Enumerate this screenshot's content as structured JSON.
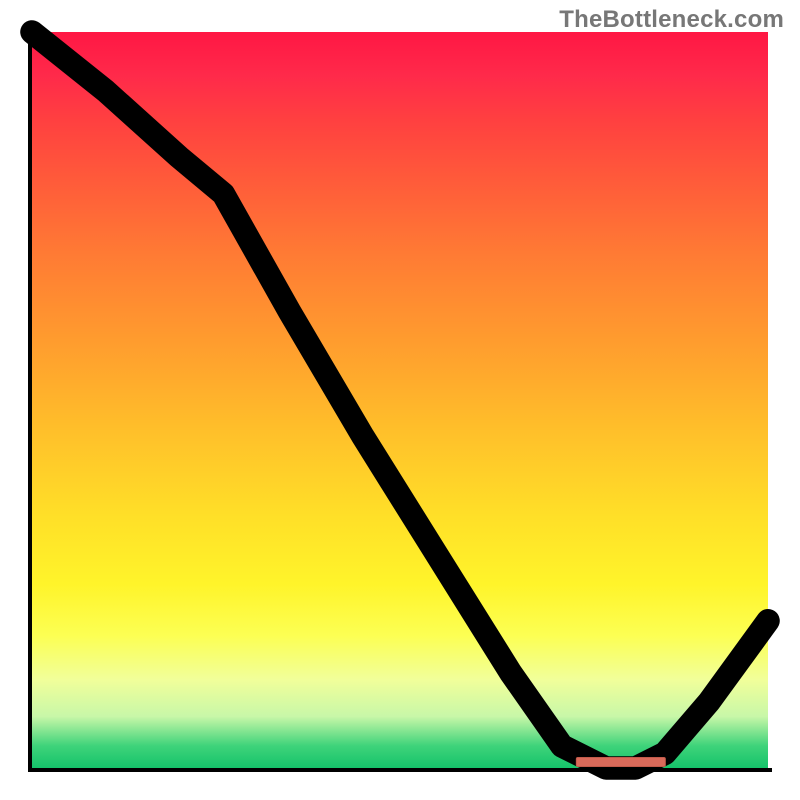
{
  "watermark": "TheBottleneck.com",
  "chart_data": {
    "type": "line",
    "title": "",
    "xlabel": "",
    "ylabel": "",
    "xlim": [
      0,
      100
    ],
    "ylim": [
      0,
      100
    ],
    "grid": false,
    "legend": false,
    "background": "red-yellow-green-gradient",
    "series": [
      {
        "name": "curve",
        "x": [
          0,
          10,
          20,
          26,
          35,
          45,
          55,
          65,
          72,
          78,
          82,
          86,
          92,
          100
        ],
        "y": [
          100,
          92,
          83,
          78,
          62,
          45,
          29,
          13,
          3,
          0,
          0,
          2,
          9,
          20
        ]
      }
    ],
    "markers": [
      {
        "name": "optimum-range",
        "x_center": 80,
        "y": 0.7,
        "width_pct": 12
      }
    ]
  },
  "colors": {
    "gradient_top": "#ff1744",
    "gradient_mid": "#ffe028",
    "gradient_bottom": "#15c36a",
    "curve": "#000000",
    "marker": "#d96a5a"
  }
}
